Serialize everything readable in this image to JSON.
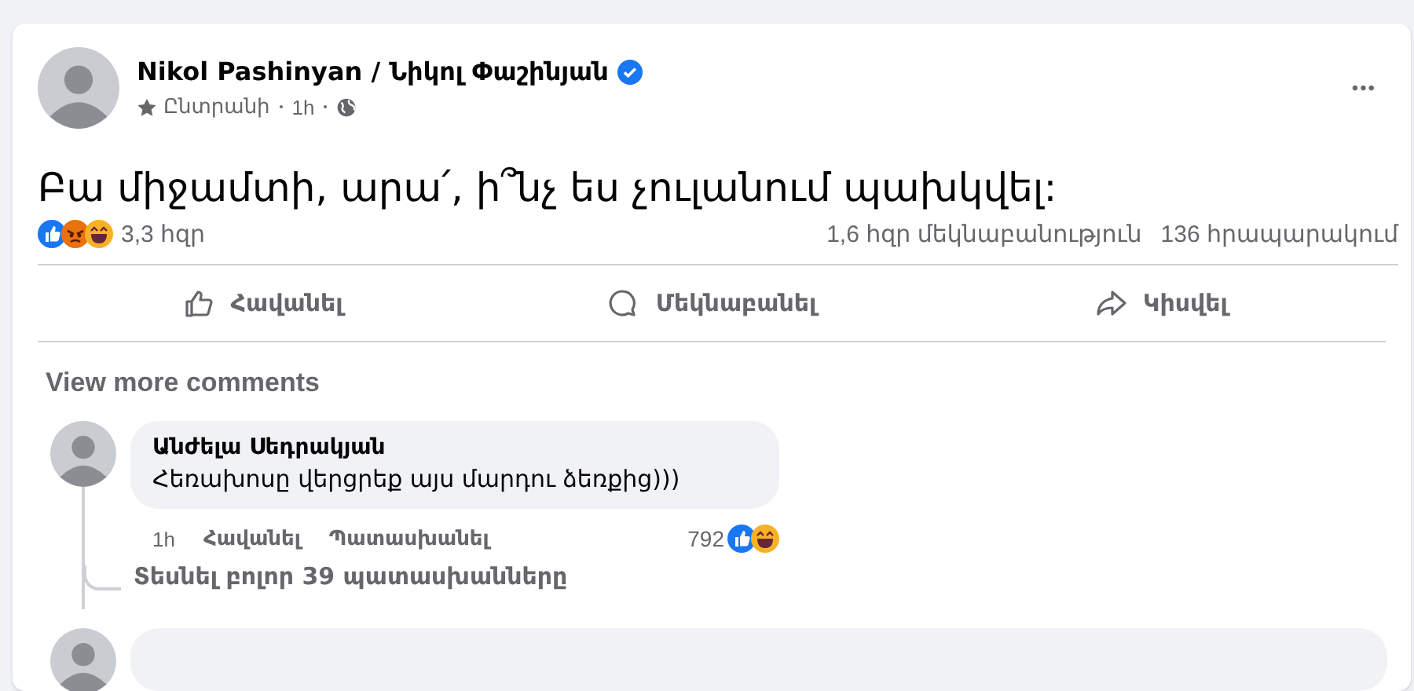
{
  "post": {
    "author": "Nikol Pashinyan / Նիկոլ Փաշինյան",
    "verified": true,
    "audience": "Ընտրանի",
    "time": "1h",
    "more": "•••",
    "text": "Բա միջամտի, արա՛, ի՞նչ ես չուլանում պախկվել:"
  },
  "stats": {
    "reactions_count": "3,3 հզր",
    "comments": "1,6 հզր մեկնաբանություն",
    "shares": "136 հրապարակում"
  },
  "actions": [
    {
      "kind": "like",
      "label": "Հավանել"
    },
    {
      "kind": "comment",
      "label": "Մեկնաբանել"
    },
    {
      "kind": "share",
      "label": "Կիսվել"
    }
  ],
  "view_more": "View more comments",
  "comments": [
    {
      "author": "Անժելա Սեդրակյան",
      "text": "Հեռախոսը վերցրեք այս մարդու ձեռքից)))",
      "time": "1h",
      "like": "Հավանել",
      "reply": "Պատասխանել",
      "reactions_count": "792",
      "replies_link": "Տեսնել բոլոր 39 պատասխանները"
    }
  ]
}
